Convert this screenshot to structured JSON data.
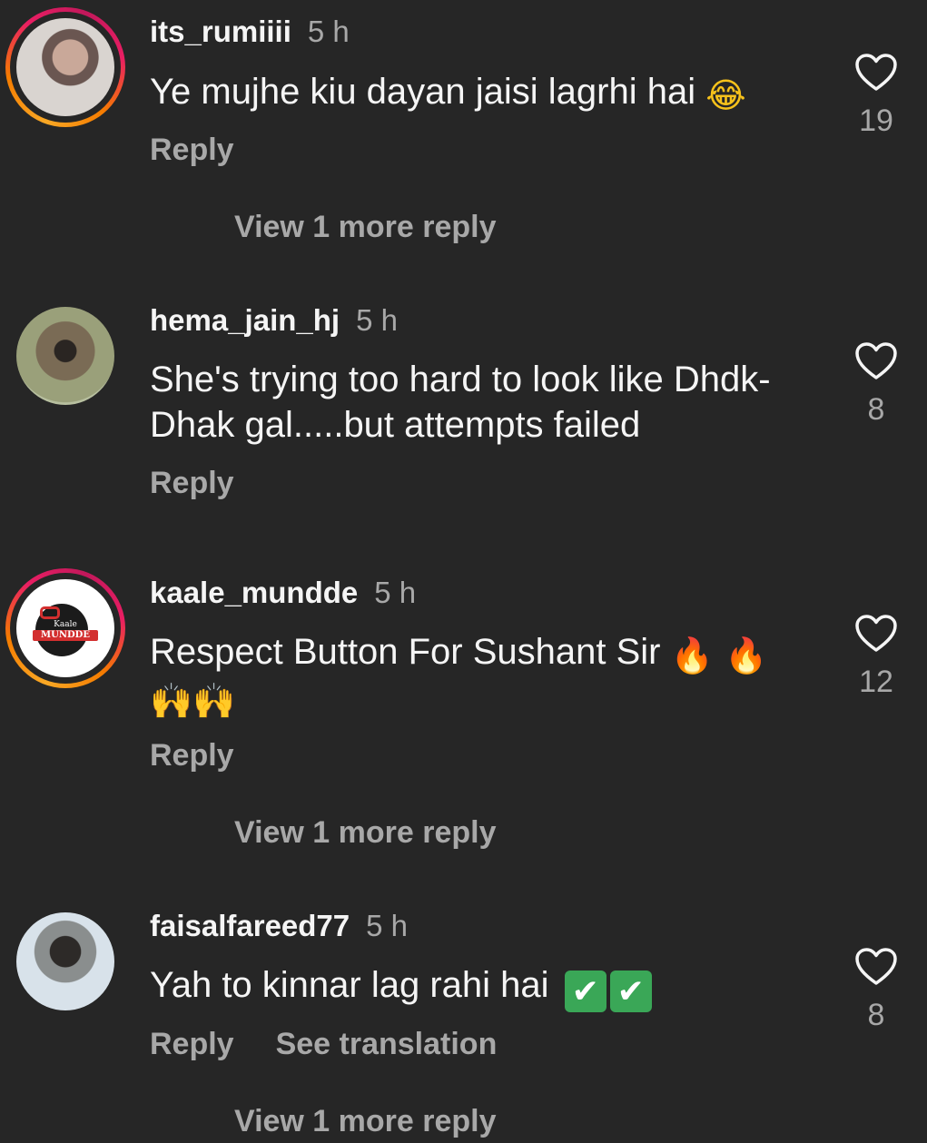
{
  "colors": {
    "background": "#262626",
    "primary_text": "#f5f5f5",
    "secondary_text": "#a8a8a8",
    "story_ring": "#e91e63"
  },
  "comments": [
    {
      "username": "its_rumiiii",
      "time": "5 h",
      "text": "Ye mujhe kiu dayan jaisi lagrhi hai",
      "emojis": "😂",
      "reply_label": "Reply",
      "likes": "19",
      "view_more": "View 1 more reply"
    },
    {
      "username": "hema_jain_hj",
      "time": "5 h",
      "text": "She's trying too hard to look like Dhdk-Dhak gal.....but attempts failed",
      "reply_label": "Reply",
      "likes": "8"
    },
    {
      "username": "kaale_mundde",
      "time": "5 h",
      "text": "Respect Button For Sushant Sir",
      "emojis_fire": "🔥 🔥",
      "emojis_hands": "🙌🙌",
      "reply_label": "Reply",
      "likes": "12",
      "view_more": "View 1 more reply",
      "avatar_logo_small": "Kaale",
      "avatar_logo_main": "MUNDDE"
    },
    {
      "username": "faisalfareed77",
      "time": "5 h",
      "text": "Yah to kinnar lag rahi hai",
      "emojis": [
        "✔",
        "✔"
      ],
      "reply_label": "Reply",
      "translate_label": "See translation",
      "likes": "8",
      "view_more": "View 1 more reply"
    }
  ],
  "icons": {
    "like": "heart-outline-icon"
  }
}
